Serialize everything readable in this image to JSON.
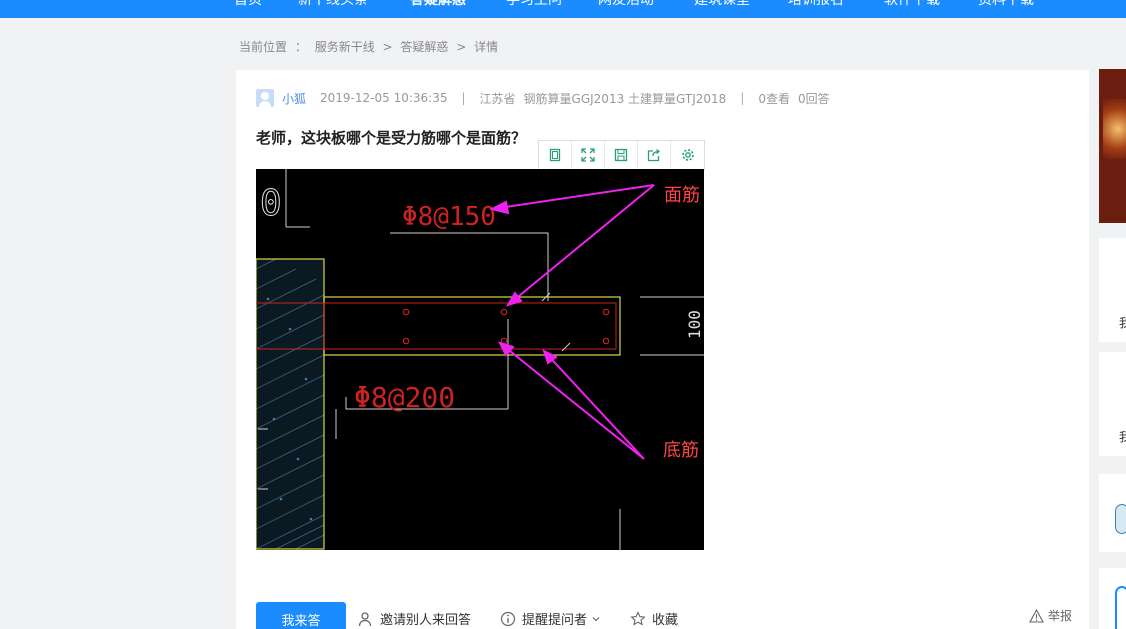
{
  "nav": {
    "items": [
      {
        "label": "首页"
      },
      {
        "label": "新干线头条"
      },
      {
        "label": "答疑解惑"
      },
      {
        "label": "学习生问"
      },
      {
        "label": "网友活动"
      },
      {
        "label": "建筑课堂"
      },
      {
        "label": "培训报名"
      },
      {
        "label": "软件下载"
      },
      {
        "label": "资料下载"
      }
    ]
  },
  "breadcrumb": {
    "prefix": "当前位置",
    "colon": "：",
    "level1": "服务新干线",
    "sep": ">",
    "level2": "答疑解惑",
    "level3": "详情"
  },
  "question": {
    "author": "小狐",
    "datetime": "2019-12-05 10:36:35",
    "divider": "|",
    "region": "江苏省",
    "software": "钢筋算量GGJ2013 土建算量GTJ2018",
    "views": "0查看",
    "answers": "0回答",
    "title": "老师，这块板哪个是受力筋哪个是面筋？"
  },
  "image_toolbar": {
    "icons": [
      "fit-icon",
      "fullscreen-icon",
      "save-icon",
      "share-icon",
      "settings-icon"
    ]
  },
  "cad_image": {
    "label_top": "面筋",
    "label_bottom": "底筋",
    "rebar_top": "Φ8@150",
    "rebar_bottom": "Φ8@200",
    "dim_right": "100",
    "colors": {
      "background": "#000000",
      "arrow": "#ee22ee",
      "rebar_text": "#dd2222",
      "label_text": "#ff4444"
    }
  },
  "actions": {
    "answer": "我来答",
    "invite": "邀请别人来回答",
    "remind": "提醒提问者",
    "favorite": "收藏",
    "report": "举报"
  },
  "sidebar": {
    "card1_text": "我",
    "card2_text": "我"
  },
  "colors": {
    "primary": "#1a8cff",
    "page_bg": "#f1f2f4",
    "toolbar_icon": "#2aa070"
  }
}
